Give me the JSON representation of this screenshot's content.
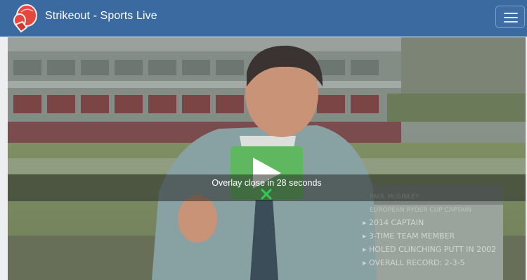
{
  "site": {
    "title": "Strikeout - Sports Live",
    "logo_icon": "boxing-glove-icon",
    "menu_icon": "hamburger-menu-icon"
  },
  "colors": {
    "navbar": "#3b6aa0",
    "play_button": "#5fb85f",
    "close_icon": "#2ecc55"
  },
  "player": {
    "play_icon": "play-icon",
    "overlay_message": "Overlay close in 28 seconds",
    "close_icon": "close-icon"
  },
  "video_frame": {
    "graphic_lines": [
      "PAUL McGINLEY",
      "EUROPEAN RYDER CUP CAPTAIN",
      "2014 CAPTAIN",
      "3-TIME TEAM MEMBER",
      "HOLED CLINCHING PUTT IN 2002",
      "OVERALL RECORD: 2-3-5"
    ]
  }
}
